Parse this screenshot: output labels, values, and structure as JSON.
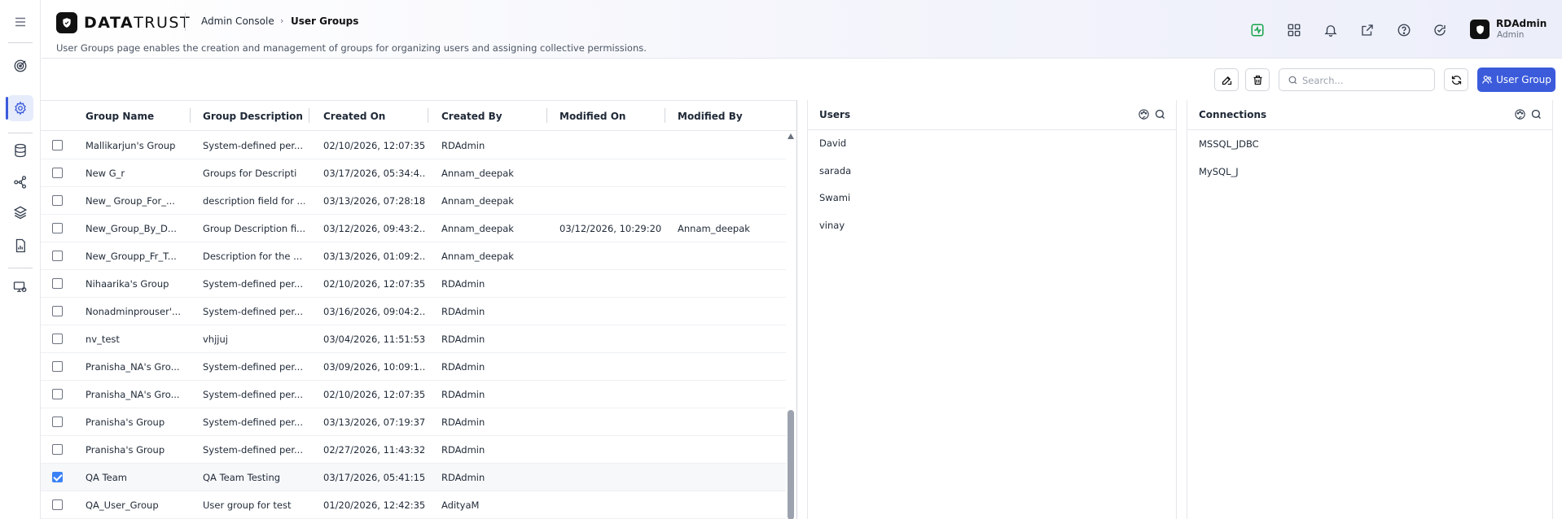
{
  "app": {
    "logo_bold": "DATA",
    "logo_light": "TRUST"
  },
  "breadcrumb": {
    "parent": "Admin Console",
    "separator": "›",
    "current": "User Groups"
  },
  "page": {
    "description": "User Groups page enables the creation and management of groups for organizing users and assigning collective permissions."
  },
  "header_icons": [
    "activity-icon",
    "grid-icon",
    "bell-icon",
    "external-link-icon",
    "help-icon",
    "refresh-check-icon"
  ],
  "user": {
    "name": "RDAdmin",
    "role": "Admin"
  },
  "toolbar": {
    "search_placeholder": "Search...",
    "add_label": "User Group"
  },
  "table": {
    "columns": [
      "Group Name",
      "Group Description",
      "Created On",
      "Created By",
      "Modified On",
      "Modified By"
    ],
    "rows": [
      {
        "checked": false,
        "name": "Mallikarjun's Group",
        "description": "System-defined per...",
        "created_on": "02/10/2026, 12:07:35...",
        "created_by": "RDAdmin",
        "modified_on": "",
        "modified_by": ""
      },
      {
        "checked": false,
        "name": "New G_r",
        "description": "Groups for Descripti",
        "created_on": "03/17/2026, 05:34:4...",
        "created_by": "Annam_deepak",
        "modified_on": "",
        "modified_by": ""
      },
      {
        "checked": false,
        "name": "New_ Group_For_...",
        "description": "description field for ...",
        "created_on": "03/13/2026, 07:28:18...",
        "created_by": "Annam_deepak",
        "modified_on": "",
        "modified_by": ""
      },
      {
        "checked": false,
        "name": "New_Group_By_D...",
        "description": "Group Description fi...",
        "created_on": "03/12/2026, 09:43:2...",
        "created_by": "Annam_deepak",
        "modified_on": "03/12/2026, 10:29:20...",
        "modified_by": "Annam_deepak"
      },
      {
        "checked": false,
        "name": "New_Groupp_Fr_T...",
        "description": "Description for the ...",
        "created_on": "03/13/2026, 01:09:2...",
        "created_by": "Annam_deepak",
        "modified_on": "",
        "modified_by": ""
      },
      {
        "checked": false,
        "name": "Nihaarika's Group",
        "description": "System-defined per...",
        "created_on": "02/10/2026, 12:07:35...",
        "created_by": "RDAdmin",
        "modified_on": "",
        "modified_by": ""
      },
      {
        "checked": false,
        "name": "Nonadminprouser'...",
        "description": "System-defined per...",
        "created_on": "03/16/2026, 09:04:2...",
        "created_by": "RDAdmin",
        "modified_on": "",
        "modified_by": ""
      },
      {
        "checked": false,
        "name": "nv_test",
        "description": "vhjjuj",
        "created_on": "03/04/2026, 11:51:53...",
        "created_by": "RDAdmin",
        "modified_on": "",
        "modified_by": ""
      },
      {
        "checked": false,
        "name": "Pranisha_NA's Gro...",
        "description": "System-defined per...",
        "created_on": "03/09/2026, 10:09:1...",
        "created_by": "RDAdmin",
        "modified_on": "",
        "modified_by": ""
      },
      {
        "checked": false,
        "name": "Pranisha_NA's Gro...",
        "description": "System-defined per...",
        "created_on": "02/10/2026, 12:07:35...",
        "created_by": "RDAdmin",
        "modified_on": "",
        "modified_by": ""
      },
      {
        "checked": false,
        "name": "Pranisha's Group",
        "description": "System-defined per...",
        "created_on": "03/13/2026, 07:19:37...",
        "created_by": "RDAdmin",
        "modified_on": "",
        "modified_by": ""
      },
      {
        "checked": false,
        "name": "Pranisha's Group",
        "description": "System-defined per...",
        "created_on": "02/27/2026, 11:43:32...",
        "created_by": "RDAdmin",
        "modified_on": "",
        "modified_by": ""
      },
      {
        "checked": true,
        "name": "QA Team",
        "description": "QA Team Testing",
        "created_on": "03/17/2026, 05:41:15...",
        "created_by": "RDAdmin",
        "modified_on": "",
        "modified_by": ""
      },
      {
        "checked": false,
        "name": "QA_User_Group",
        "description": "User group for test",
        "created_on": "01/20/2026, 12:42:35...",
        "created_by": "AdityaM",
        "modified_on": "",
        "modified_by": ""
      }
    ]
  },
  "users_panel": {
    "title": "Users",
    "items": [
      "David",
      "sarada",
      "Swami",
      "vinay"
    ]
  },
  "connections_panel": {
    "title": "Connections",
    "items": [
      "MSSQL_JDBC",
      "MySQL_J"
    ]
  },
  "colors": {
    "accent": "#3b5bdb",
    "active_nav_bg": "#e6ecfb",
    "activity_green": "#16a34a"
  }
}
